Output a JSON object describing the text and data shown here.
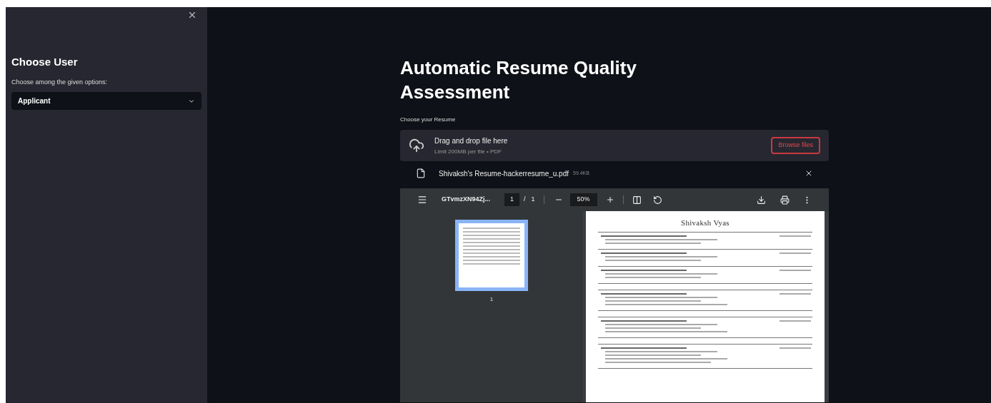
{
  "sidebar": {
    "title": "Choose User",
    "select": {
      "label": "Choose among the given options:",
      "value": "Applicant"
    }
  },
  "main": {
    "title": "Automatic Resume Quality Assessment",
    "uploader": {
      "label": "Choose your Resume",
      "dropzone": {
        "title": "Drag and drop file here",
        "hint": "Limit 200MB per file • PDF",
        "button": "Browse files"
      },
      "files": [
        {
          "name": "Shivaksh's Resume-hackerresume_u.pdf",
          "size": "59.4KB"
        }
      ]
    },
    "viewer": {
      "toolbar": {
        "filename": "GTvmzXN94Zj...",
        "page": "1",
        "separator": "/",
        "total": "1",
        "zoom": "50%"
      },
      "thumbnails": [
        {
          "label": "1",
          "selected": true
        }
      ],
      "page": {
        "heading": "Shivaksh Vyas"
      }
    }
  }
}
